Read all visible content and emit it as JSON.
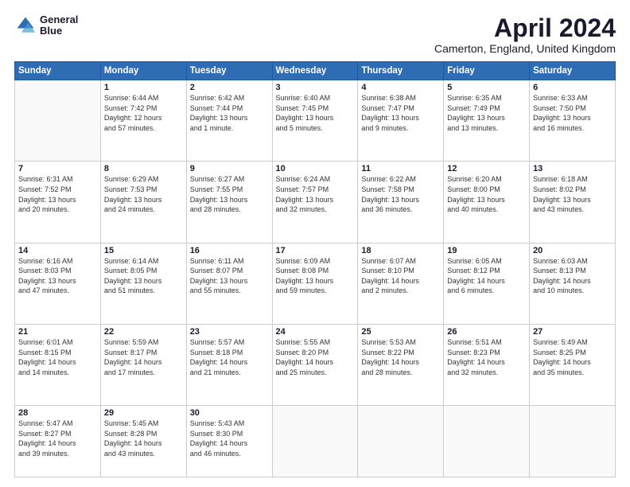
{
  "logo": {
    "line1": "General",
    "line2": "Blue"
  },
  "title": "April 2024",
  "subtitle": "Camerton, England, United Kingdom",
  "days_of_week": [
    "Sunday",
    "Monday",
    "Tuesday",
    "Wednesday",
    "Thursday",
    "Friday",
    "Saturday"
  ],
  "weeks": [
    [
      {
        "day": "",
        "info": ""
      },
      {
        "day": "1",
        "info": "Sunrise: 6:44 AM\nSunset: 7:42 PM\nDaylight: 12 hours\nand 57 minutes."
      },
      {
        "day": "2",
        "info": "Sunrise: 6:42 AM\nSunset: 7:44 PM\nDaylight: 13 hours\nand 1 minute."
      },
      {
        "day": "3",
        "info": "Sunrise: 6:40 AM\nSunset: 7:45 PM\nDaylight: 13 hours\nand 5 minutes."
      },
      {
        "day": "4",
        "info": "Sunrise: 6:38 AM\nSunset: 7:47 PM\nDaylight: 13 hours\nand 9 minutes."
      },
      {
        "day": "5",
        "info": "Sunrise: 6:35 AM\nSunset: 7:49 PM\nDaylight: 13 hours\nand 13 minutes."
      },
      {
        "day": "6",
        "info": "Sunrise: 6:33 AM\nSunset: 7:50 PM\nDaylight: 13 hours\nand 16 minutes."
      }
    ],
    [
      {
        "day": "7",
        "info": "Sunrise: 6:31 AM\nSunset: 7:52 PM\nDaylight: 13 hours\nand 20 minutes."
      },
      {
        "day": "8",
        "info": "Sunrise: 6:29 AM\nSunset: 7:53 PM\nDaylight: 13 hours\nand 24 minutes."
      },
      {
        "day": "9",
        "info": "Sunrise: 6:27 AM\nSunset: 7:55 PM\nDaylight: 13 hours\nand 28 minutes."
      },
      {
        "day": "10",
        "info": "Sunrise: 6:24 AM\nSunset: 7:57 PM\nDaylight: 13 hours\nand 32 minutes."
      },
      {
        "day": "11",
        "info": "Sunrise: 6:22 AM\nSunset: 7:58 PM\nDaylight: 13 hours\nand 36 minutes."
      },
      {
        "day": "12",
        "info": "Sunrise: 6:20 AM\nSunset: 8:00 PM\nDaylight: 13 hours\nand 40 minutes."
      },
      {
        "day": "13",
        "info": "Sunrise: 6:18 AM\nSunset: 8:02 PM\nDaylight: 13 hours\nand 43 minutes."
      }
    ],
    [
      {
        "day": "14",
        "info": "Sunrise: 6:16 AM\nSunset: 8:03 PM\nDaylight: 13 hours\nand 47 minutes."
      },
      {
        "day": "15",
        "info": "Sunrise: 6:14 AM\nSunset: 8:05 PM\nDaylight: 13 hours\nand 51 minutes."
      },
      {
        "day": "16",
        "info": "Sunrise: 6:11 AM\nSunset: 8:07 PM\nDaylight: 13 hours\nand 55 minutes."
      },
      {
        "day": "17",
        "info": "Sunrise: 6:09 AM\nSunset: 8:08 PM\nDaylight: 13 hours\nand 59 minutes."
      },
      {
        "day": "18",
        "info": "Sunrise: 6:07 AM\nSunset: 8:10 PM\nDaylight: 14 hours\nand 2 minutes."
      },
      {
        "day": "19",
        "info": "Sunrise: 6:05 AM\nSunset: 8:12 PM\nDaylight: 14 hours\nand 6 minutes."
      },
      {
        "day": "20",
        "info": "Sunrise: 6:03 AM\nSunset: 8:13 PM\nDaylight: 14 hours\nand 10 minutes."
      }
    ],
    [
      {
        "day": "21",
        "info": "Sunrise: 6:01 AM\nSunset: 8:15 PM\nDaylight: 14 hours\nand 14 minutes."
      },
      {
        "day": "22",
        "info": "Sunrise: 5:59 AM\nSunset: 8:17 PM\nDaylight: 14 hours\nand 17 minutes."
      },
      {
        "day": "23",
        "info": "Sunrise: 5:57 AM\nSunset: 8:18 PM\nDaylight: 14 hours\nand 21 minutes."
      },
      {
        "day": "24",
        "info": "Sunrise: 5:55 AM\nSunset: 8:20 PM\nDaylight: 14 hours\nand 25 minutes."
      },
      {
        "day": "25",
        "info": "Sunrise: 5:53 AM\nSunset: 8:22 PM\nDaylight: 14 hours\nand 28 minutes."
      },
      {
        "day": "26",
        "info": "Sunrise: 5:51 AM\nSunset: 8:23 PM\nDaylight: 14 hours\nand 32 minutes."
      },
      {
        "day": "27",
        "info": "Sunrise: 5:49 AM\nSunset: 8:25 PM\nDaylight: 14 hours\nand 35 minutes."
      }
    ],
    [
      {
        "day": "28",
        "info": "Sunrise: 5:47 AM\nSunset: 8:27 PM\nDaylight: 14 hours\nand 39 minutes."
      },
      {
        "day": "29",
        "info": "Sunrise: 5:45 AM\nSunset: 8:28 PM\nDaylight: 14 hours\nand 43 minutes."
      },
      {
        "day": "30",
        "info": "Sunrise: 5:43 AM\nSunset: 8:30 PM\nDaylight: 14 hours\nand 46 minutes."
      },
      {
        "day": "",
        "info": ""
      },
      {
        "day": "",
        "info": ""
      },
      {
        "day": "",
        "info": ""
      },
      {
        "day": "",
        "info": ""
      }
    ]
  ]
}
